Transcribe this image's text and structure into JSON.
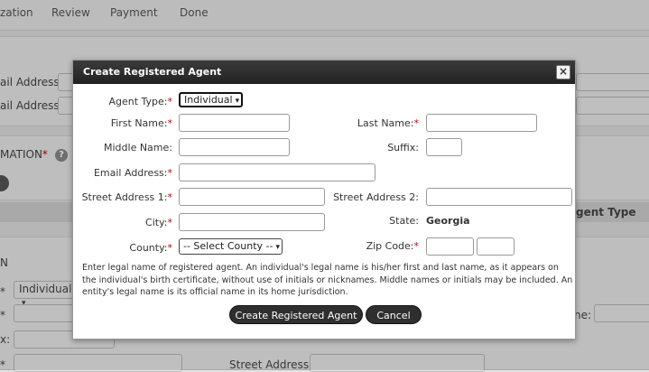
{
  "background": {
    "steps": [
      "zation",
      "Review",
      "Payment",
      "Done"
    ],
    "email_label_1": "ail Address:",
    "email_label_2": "ail Address:",
    "section_title": "MATION",
    "table_header": "gent Type",
    "section_letter": "N",
    "agent_type_select": "Individual",
    "x_label": "x:",
    "ne_label": "ne:",
    "street2_label": "Street Address 2:",
    "req_mark": "*"
  },
  "modal": {
    "title": "Create Registered Agent",
    "close_label": "×",
    "fields": {
      "agent_type": {
        "label": "Agent Type:",
        "value": "Individual"
      },
      "first_name": {
        "label": "First Name:",
        "value": ""
      },
      "last_name": {
        "label": "Last Name:",
        "value": ""
      },
      "middle_name": {
        "label": "Middle Name:",
        "value": ""
      },
      "suffix": {
        "label": "Suffix:",
        "value": ""
      },
      "email": {
        "label": "Email Address:",
        "value": ""
      },
      "street1": {
        "label": "Street Address 1:",
        "value": ""
      },
      "street2": {
        "label": "Street Address 2:",
        "value": ""
      },
      "city": {
        "label": "City:",
        "value": ""
      },
      "state": {
        "label": "State:",
        "value": "Georgia"
      },
      "county": {
        "label": "County:",
        "value": "-- Select County --"
      },
      "zip": {
        "label": "Zip Code:",
        "value": "",
        "value_ext": ""
      }
    },
    "note": "Enter legal name of registered agent. An individual's legal name is his/her first and last name, as it appears on the individual's birth certificate, without use of initials or nicknames. Middle names or initials may be included. An entity's legal name is its official name in its home jurisdiction.",
    "create_button": "Create Registered Agent",
    "cancel_button": "Cancel"
  }
}
